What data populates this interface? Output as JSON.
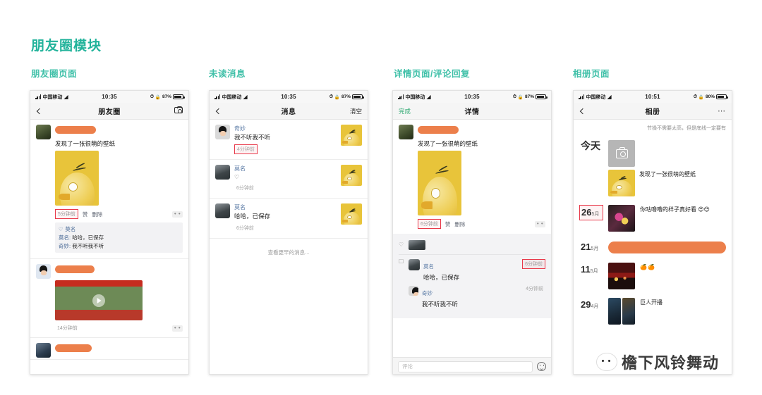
{
  "heading": {
    "title": "朋友圈模块",
    "accent_color": "#22b39b"
  },
  "sections": [
    {
      "label": "朋友圈页面"
    },
    {
      "label": "未读消息"
    },
    {
      "label": "详情页面/评论回复"
    },
    {
      "label": "相册页面"
    }
  ],
  "status_bar": {
    "carrier": "中国移动",
    "time_1035": "10:35",
    "time_1051": "10:51",
    "battery_87": "87%",
    "battery_80": "80%"
  },
  "phone1": {
    "nav": {
      "title": "朋友圈",
      "back_icon": "chevron-left-icon",
      "camera_icon": "camera-icon"
    },
    "post1": {
      "author_redacted": true,
      "text": "发现了一张很萌的壁纸",
      "time": "5分钟前",
      "action_like": "赞",
      "action_delete": "删除",
      "more": "• •",
      "likes_name": "莫名",
      "comments": [
        {
          "name": "莫名:",
          "text": "哈哈，已保存"
        },
        {
          "name": "奇妙:",
          "text": "我不听我不听"
        }
      ]
    },
    "post2": {
      "author_redacted": true,
      "time": "14分钟前",
      "more": "• •",
      "media": "video-thumbnail"
    },
    "post3": {
      "author_redacted": true
    }
  },
  "phone2": {
    "nav": {
      "title": "消息",
      "back_icon": "chevron-left-icon",
      "clear_label": "清空"
    },
    "messages": [
      {
        "name": "奇妙",
        "text": "我不听我不听",
        "time": "4分钟前",
        "highlight": true,
        "thumb": "duck"
      },
      {
        "name": "莫名",
        "text": "♡",
        "is_like": true,
        "time": "6分钟前",
        "thumb": "duck"
      },
      {
        "name": "莫名",
        "text": "哈哈，已保存",
        "time": "6分钟前",
        "thumb": "duck"
      }
    ],
    "load_more": "查看更早的消息..."
  },
  "phone3": {
    "nav": {
      "title": "详情",
      "done_label": "完成"
    },
    "post": {
      "author_redacted": true,
      "text": "发现了一张很萌的壁纸",
      "time": "6分钟前",
      "action_like": "赞",
      "action_delete": "删除",
      "more": "• •"
    },
    "like_row": {
      "icon": "heart-icon"
    },
    "comment": {
      "icon": "comment-icon",
      "name": "莫名",
      "text": "哈哈，已保存",
      "time": "6分钟前"
    },
    "reply": {
      "name": "奇妙",
      "text": "我不听我不听",
      "time": "4分钟前"
    },
    "reply_bar": {
      "placeholder": "评论",
      "emoji_icon": "smiley-icon"
    }
  },
  "phone4": {
    "nav": {
      "title": "相册",
      "back_icon": "chevron-left-icon",
      "more_icon": "dots-icon"
    },
    "signature": "节操不需要太高，但是底线一定要有",
    "rows": [
      {
        "date_day": "今天",
        "date_month": "",
        "is_today": true,
        "caption": "发现了一张很萌的壁纸",
        "thumbs": [
          "camera-placeholder",
          "duck"
        ]
      },
      {
        "date_day": "26",
        "date_month": "5月",
        "caption": "你咕噜噜的样子真好看 😍😍",
        "thumbs": [
          "flower"
        ],
        "highlight": true
      },
      {
        "date_day": "21",
        "date_month": "5月",
        "caption": "",
        "redacted": true
      },
      {
        "date_day": "11",
        "date_month": "5月",
        "caption": "🍊🍊",
        "thumbs": [
          "concert"
        ]
      },
      {
        "date_day": "29",
        "date_month": "4月",
        "caption": "巨人开播",
        "thumbs": [
          "anime"
        ]
      }
    ]
  },
  "watermark": {
    "text": "檐下风铃舞动",
    "logo": "wechat-logo-icon"
  }
}
